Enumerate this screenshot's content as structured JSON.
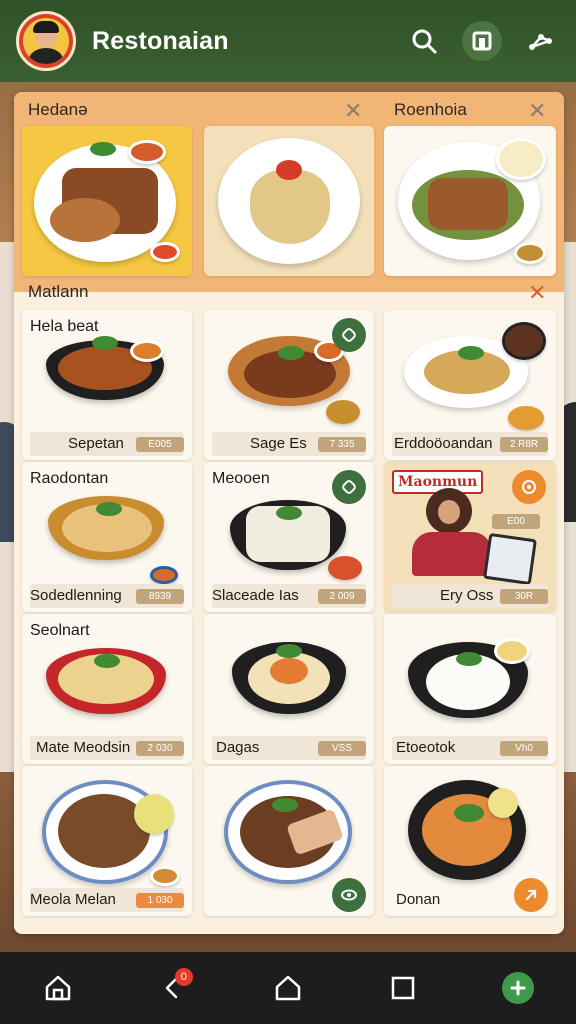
{
  "app": {
    "title": "Restonaian",
    "accent_color": "#2f5128"
  },
  "topbar": {
    "icons": [
      "search-icon",
      "square-icon",
      "share-icon"
    ]
  },
  "categories": [
    {
      "header": "Hedanə",
      "cards": [
        {
          "title": "",
          "name": "",
          "price": ""
        },
        {
          "title": "",
          "name": "",
          "price": ""
        }
      ]
    },
    {
      "header": "Roenhoia",
      "cards": [
        {
          "title": "",
          "name": "",
          "price": ""
        }
      ]
    },
    {
      "header": "Matlann",
      "cards": [
        {
          "title": "Hela beat",
          "name": "Sepetan",
          "price": "E005"
        },
        {
          "title": "",
          "name": "Sage Es",
          "price": "7 335"
        },
        {
          "title": "",
          "name": "Erddoöoandan",
          "price": "2 R8R"
        },
        {
          "title": "Raodontan",
          "name": "Sodedlenning",
          "price": "8939"
        },
        {
          "title": "Meooen",
          "name": "Slaceade Ias",
          "price": "2 009"
        },
        {
          "title": "",
          "name": "Ery Oss",
          "price": "30R"
        },
        {
          "title": "Seolnart",
          "name": "Mate Meodsin",
          "price": "2 030"
        },
        {
          "title": "",
          "name": "Dagas",
          "price": "VSS"
        },
        {
          "title": "",
          "name": "Etoeotok",
          "price": "Vh0"
        },
        {
          "title": "",
          "name": "Meola Melan",
          "price": "1 030"
        },
        {
          "title": "",
          "name": "",
          "price": ""
        },
        {
          "title": "",
          "name": "Donan",
          "price": ""
        }
      ]
    }
  ],
  "promo": {
    "brand": "Maonmun",
    "badge": "E00"
  },
  "bottomnav": {
    "items": [
      "home-icon",
      "back-icon",
      "house-icon",
      "square-icon",
      "add-icon"
    ],
    "notification_count": "0"
  }
}
